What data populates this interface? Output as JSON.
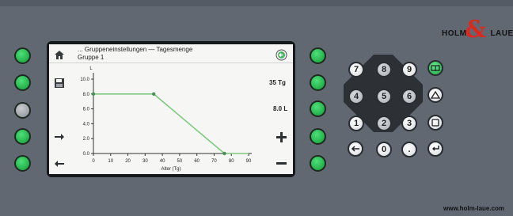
{
  "screen": {
    "breadcrumb": "... Gruppeneinstellungen — Tagesmenge",
    "subtitle": "Gruppe 1",
    "value_days": "35 Tg",
    "value_liters": "8.0 L"
  },
  "chart_data": {
    "type": "line",
    "xlabel": "Alter (Tg)",
    "ylabel": "L",
    "xlim": [
      0,
      90
    ],
    "ylim": [
      0,
      10
    ],
    "x_ticks": [
      "0",
      "10",
      "20",
      "30",
      "40",
      "50",
      "60",
      "70",
      "80",
      "90"
    ],
    "y_ticks": [
      "0.0",
      "2.0",
      "4.0",
      "6.0",
      "8.0",
      "10.0"
    ],
    "series": [
      {
        "x": [
          0,
          35,
          76,
          90
        ],
        "y": [
          8.0,
          8.0,
          0.0,
          0.0
        ]
      }
    ],
    "markers": [
      {
        "x": 0,
        "y": 8.0
      },
      {
        "x": 35,
        "y": 8.0
      },
      {
        "x": 76,
        "y": 0.0
      }
    ],
    "line_color": "#7cc97f",
    "marker_color": "#4a8f58",
    "grid": false
  },
  "keypad": {
    "keys": [
      "7",
      "8",
      "9",
      "4",
      "5",
      "6",
      "1",
      "2",
      "3",
      "0",
      "."
    ]
  },
  "brand": {
    "logo_left": "Holm",
    "ampersand": "&",
    "logo_right": "Laue",
    "url": "www.holm-laue.com"
  },
  "colors": {
    "led_green": "#2fbe57",
    "logo_red": "#d82a1f",
    "panel": "#616872"
  },
  "icons": {
    "home": "home-icon",
    "save": "save-icon",
    "back": "back-icon",
    "arrow_right": "arrow-right-icon",
    "arrow_left": "arrow-left-icon",
    "plus": "plus-icon",
    "minus": "minus-icon",
    "book": "book-icon",
    "triangle": "triangle-icon",
    "square": "square-icon",
    "enter": "enter-icon"
  }
}
